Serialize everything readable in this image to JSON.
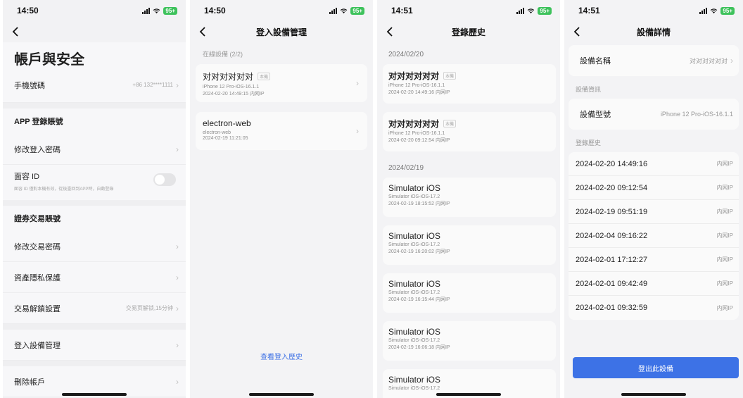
{
  "colors": {
    "accent": "#3d72e6",
    "battery": "#3ec25c",
    "link": "#3b6fe5"
  },
  "screen1": {
    "time": "14:50",
    "battery": "95+",
    "title": "帳戶與安全",
    "phone_label": "手機號碼",
    "phone_value": "+86 132****1111",
    "app_section": "APP 登錄賬號",
    "change_login_pw": "修改登入密碼",
    "face_id": "面容 ID",
    "face_id_desc": "面容 ID 僅對本機有效，從後臺回到APP時，自動登錄",
    "securities_section": "證券交易賬號",
    "change_trade_pw": "修改交易密碼",
    "asset_privacy": "資產隱私保護",
    "trade_unlock": "交易解鎖設置",
    "trade_unlock_value": "交易页解锁,15分钟",
    "device_mgmt": "登入設備管理",
    "delete_account": "刪除帳戶"
  },
  "screen2": {
    "time": "14:50",
    "battery": "95+",
    "title": "登入設備管理",
    "online_label": "在線設備 (2/2)",
    "devices": [
      {
        "name": "对对对对对对",
        "tag": "本機",
        "sub": "iPhone 12 Pro-iOS-16.1.1",
        "time": "2024-02-20 14:49:15 内网IP"
      },
      {
        "name": "electron-web",
        "tag": "",
        "sub": "electron-web",
        "time": "2024-02-19 11:21:05"
      }
    ],
    "history_link": "查看登入歷史"
  },
  "screen3": {
    "time": "14:51",
    "battery": "95+",
    "title": "登錄歷史",
    "group1_date": "2024/02/20",
    "group1": [
      {
        "name": "对对对对对对",
        "tag": "本機",
        "sub": "iPhone 12 Pro-iOS-16.1.1",
        "time": "2024-02-20 14:49:16 内网IP"
      },
      {
        "name": "对对对对对对",
        "tag": "本機",
        "sub": "iPhone 12 Pro-iOS-16.1.1",
        "time": "2024-02-20 09:12:54 内网IP"
      }
    ],
    "group2_date": "2024/02/19",
    "group2": [
      {
        "name": "Simulator iOS",
        "sub": "Simulator iOS-iOS-17.2",
        "time": "2024-02-19 18:15:52 内网IP"
      },
      {
        "name": "Simulator iOS",
        "sub": "Simulator iOS-iOS-17.2",
        "time": "2024-02-19 16:20:02 内网IP"
      },
      {
        "name": "Simulator iOS",
        "sub": "Simulator iOS-iOS-17.2",
        "time": "2024-02-19 16:15:44 内网IP"
      },
      {
        "name": "Simulator iOS",
        "sub": "Simulator iOS-iOS-17.2",
        "time": "2024-02-19 16:06:18 内网IP"
      },
      {
        "name": "Simulator iOS",
        "sub": "Simulator iOS-iOS-17.2",
        "time": ""
      }
    ]
  },
  "screen4": {
    "time": "14:51",
    "battery": "95+",
    "title": "設備詳情",
    "device_name_label": "設備名稱",
    "device_name_value": "对对对对对对",
    "device_info_label": "設備資訊",
    "model_label": "設備型號",
    "model_value": "iPhone 12 Pro-iOS-16.1.1",
    "login_history_label": "登錄歷史",
    "logins": [
      {
        "time": "2024-02-20 14:49:16",
        "ip": "内网IP"
      },
      {
        "time": "2024-02-20 09:12:54",
        "ip": "内网IP"
      },
      {
        "time": "2024-02-19 09:51:19",
        "ip": "内网IP"
      },
      {
        "time": "2024-02-04 09:16:22",
        "ip": "内网IP"
      },
      {
        "time": "2024-02-01 17:12:27",
        "ip": "内网IP"
      },
      {
        "time": "2024-02-01 09:42:49",
        "ip": "内网IP"
      },
      {
        "time": "2024-02-01 09:32:59",
        "ip": "内网IP"
      }
    ],
    "logout_button": "登出此設備"
  }
}
